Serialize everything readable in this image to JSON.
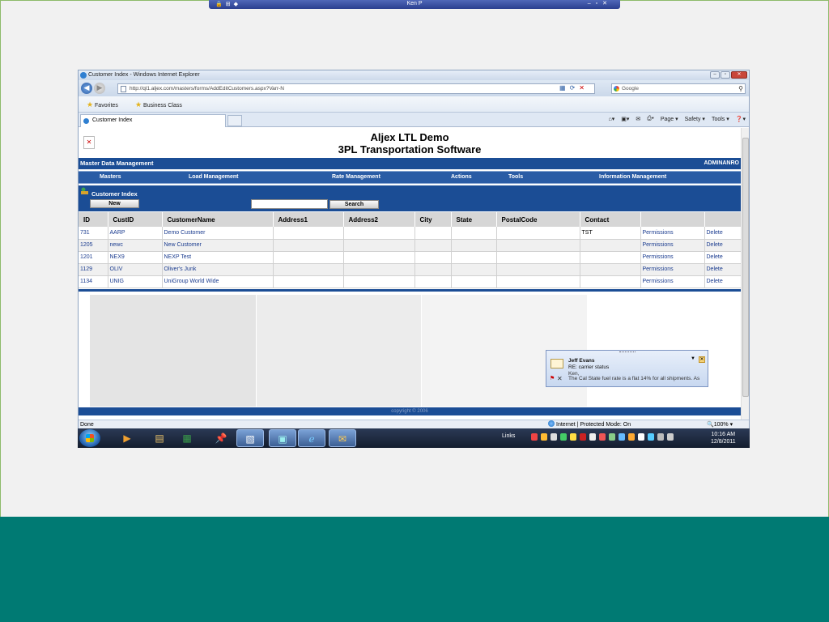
{
  "remote": {
    "session_name": "Ken P"
  },
  "browser": {
    "window_title": "Customer Index - Windows Internet Explorer",
    "url": "http://ql1.aljex.com/masters/forms/AddEditCustomers.aspx?Varr-N",
    "search_placeholder": "Google",
    "favorites_label": "Favorites",
    "fav_link": "Business Class",
    "tab_title": "Customer Index",
    "commands": {
      "page": "Page ▾",
      "safety": "Safety ▾",
      "tools": "Tools ▾"
    },
    "status_left": "Done",
    "status_zone": "Internet | Protected Mode: On",
    "zoom": "100%"
  },
  "app": {
    "title_line1": "Aljex LTL Demo",
    "title_line2": "3PL Transportation Software",
    "section": "Master Data Management",
    "user": "ADMINANRO",
    "menu": [
      "Masters",
      "Load Management",
      "Rate Management",
      "Actions",
      "Tools",
      "Information Management"
    ],
    "panel_title": "Customer Index",
    "new_button": "New",
    "search_button": "Search",
    "footer": "copyright © 2006"
  },
  "table": {
    "columns": [
      "ID",
      "CustID",
      "CustomerName",
      "Address1",
      "Address2",
      "City",
      "State",
      "PostalCode",
      "Contact",
      "",
      ""
    ],
    "rows": [
      {
        "id": "731",
        "custid": "AARP",
        "name": "Demo Customer",
        "contact": "TST",
        "perm": "Permissions",
        "del": "Delete"
      },
      {
        "id": "1205",
        "custid": "newc",
        "name": "New Customer",
        "contact": "",
        "perm": "Permissions",
        "del": "Delete"
      },
      {
        "id": "1201",
        "custid": "NEX9",
        "name": "NEXP Test",
        "contact": "",
        "perm": "Permissions",
        "del": "Delete"
      },
      {
        "id": "1129",
        "custid": "OLIV",
        "name": "Oliver's Junk",
        "contact": "",
        "perm": "Permissions",
        "del": "Delete"
      },
      {
        "id": "1134",
        "custid": "UNIG",
        "name": "UniGroup World Wide",
        "contact": "",
        "perm": "Permissions",
        "del": "Delete"
      }
    ]
  },
  "toast": {
    "from": "Jeff Evans",
    "subject": "RE: carrier status",
    "greeting": "Ken,",
    "preview": "The Cal State fuel rate is a flat 14% for all shipments. As"
  },
  "taskbar": {
    "links_label": "Links",
    "time": "10:16 AM",
    "date": "12/8/2011"
  }
}
